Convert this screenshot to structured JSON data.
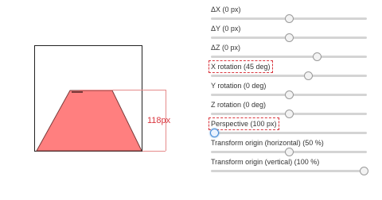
{
  "preview": {
    "measure_label": "118px",
    "face_color": "#ff7f7f",
    "guide_color": "#e58a8a"
  },
  "controls": [
    {
      "label": "ΔX (0 px)",
      "value": 0.5,
      "highlighted": false,
      "active": false
    },
    {
      "label": "ΔY (0 px)",
      "value": 0.5,
      "highlighted": false,
      "active": false
    },
    {
      "label": "ΔZ (0 px)",
      "value": 0.68,
      "highlighted": false,
      "active": false
    },
    {
      "label": "X rotation (45 deg)",
      "value": 0.62,
      "highlighted": true,
      "active": false
    },
    {
      "label": "Y rotation (0 deg)",
      "value": 0.5,
      "highlighted": false,
      "active": false
    },
    {
      "label": "Z rotation (0 deg)",
      "value": 0.5,
      "highlighted": false,
      "active": false
    },
    {
      "label": "Perspective (100 px)",
      "value": 0.02,
      "highlighted": true,
      "active": true
    },
    {
      "label": "Transform origin (horizontal) (50 %)",
      "value": 0.5,
      "highlighted": false,
      "active": false
    },
    {
      "label": "Transform origin (vertical) (100 %)",
      "value": 0.98,
      "highlighted": false,
      "active": false
    }
  ]
}
